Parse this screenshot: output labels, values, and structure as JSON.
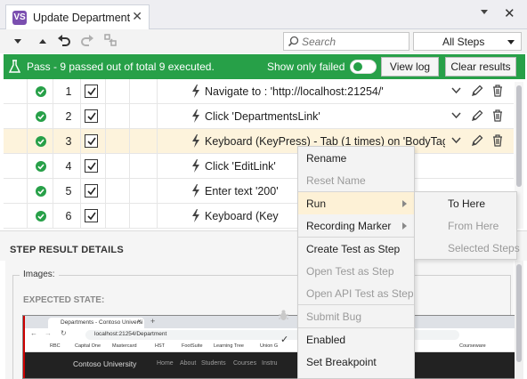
{
  "tab": {
    "title": "Update Department",
    "app_icon": "VS"
  },
  "window": {
    "close_glyph": "✕"
  },
  "toolbar": {
    "search_placeholder": "Search",
    "filter_value": "All Steps"
  },
  "status": {
    "text": "Pass - 9 passed out of total 9 executed.",
    "show_only_failed_label": "Show only failed",
    "show_only_failed_on": false,
    "view_log_label": "View log",
    "clear_results_label": "Clear results",
    "color": "#27a048"
  },
  "steps": [
    {
      "num": "1",
      "desc": "Navigate to : 'http://localhost:21254/'"
    },
    {
      "num": "2",
      "desc": "Click 'DepartmentsLink'"
    },
    {
      "num": "3",
      "desc": "Keyboard (KeyPress) - Tab (1 times) on 'BodyTag'"
    },
    {
      "num": "4",
      "desc": "Click 'EditLink'"
    },
    {
      "num": "5",
      "desc": "Enter text '200'"
    },
    {
      "num": "6",
      "desc": "Keyboard (Key"
    }
  ],
  "details": {
    "header": "STEP RESULT DETAILS",
    "images_label": "Images:",
    "expected_label": "EXPECTED STATE:"
  },
  "screenshot": {
    "tab_title": "Departments - Contoso Universi",
    "url": "localhost:21254/Department",
    "bookmarks": [
      "RBC",
      "Capital One",
      "Mastercard",
      "HST",
      "FootSuite",
      "Learning Tree",
      "Union G",
      "Courseware"
    ],
    "nav": [
      "Contoso University",
      "Home",
      "About",
      "Students",
      "Courses",
      "Instru"
    ]
  },
  "context_menu": {
    "items": [
      "Rename",
      "Reset Name",
      "Run",
      "Recording Marker",
      "Create Test as Step",
      "Open Test as Step",
      "Open API Test as Step",
      "Submit Bug",
      "Enabled",
      "Set Breakpoint"
    ],
    "enabled_check": "✓"
  },
  "run_submenu": {
    "items": [
      "To Here",
      "From Here",
      "Selected Steps"
    ]
  }
}
